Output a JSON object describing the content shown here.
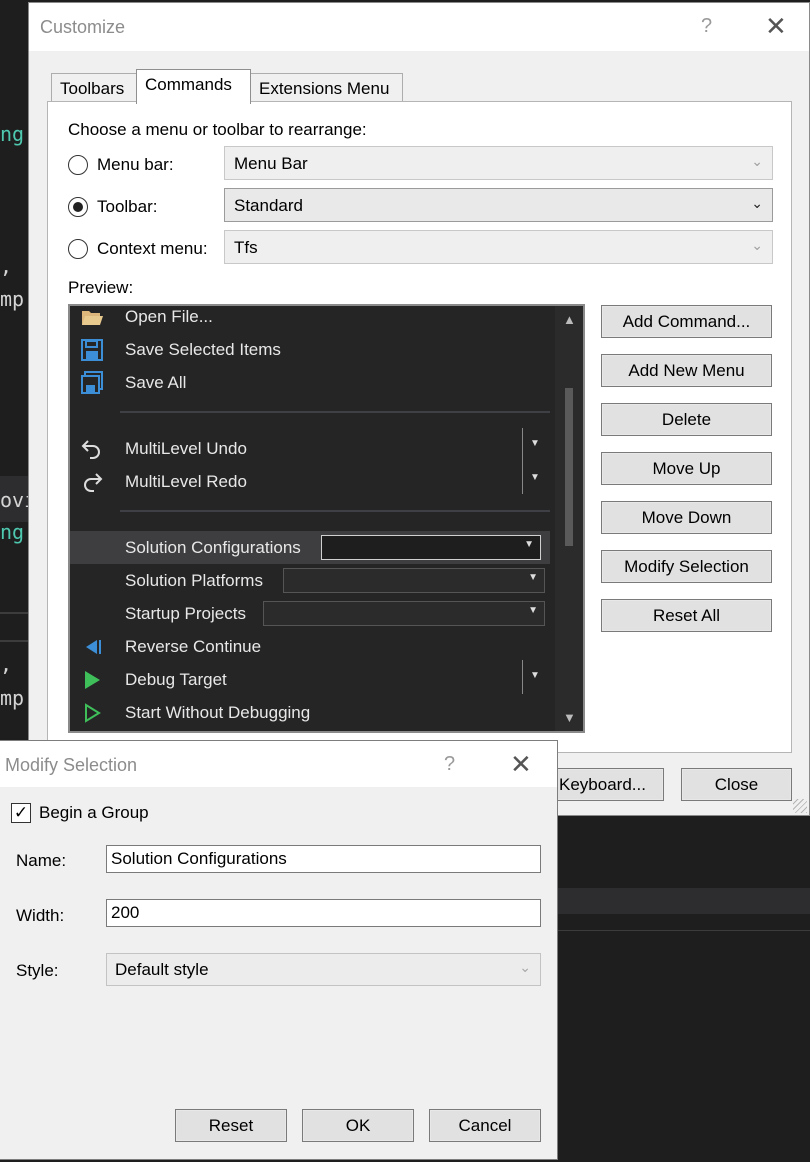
{
  "background": {
    "fragments": [
      ",",
      "mp",
      "ng",
      "ng",
      "ovi",
      ",",
      "mp"
    ]
  },
  "customize": {
    "title": "Customize",
    "help": "?",
    "close": "✕",
    "tabs": [
      "Toolbars",
      "Commands",
      "Extensions Menu"
    ],
    "active_tab": "Commands",
    "prompt": "Choose a menu or toolbar to rearrange:",
    "menu_bar": {
      "label": "Menu bar:",
      "value": "Menu Bar",
      "selected": false
    },
    "toolbar": {
      "label": "Toolbar:",
      "value": "Standard",
      "selected": true
    },
    "context_menu": {
      "label": "Context menu:",
      "value": "Tfs",
      "selected": false
    },
    "preview_label": "Preview:",
    "preview_items": {
      "open_file": "Open File...",
      "save_selected": "Save Selected Items",
      "save_all": "Save All",
      "undo": "MultiLevel Undo",
      "redo": "MultiLevel Redo",
      "solution_configs": "Solution Configurations",
      "solution_platforms": "Solution Platforms",
      "startup_projects": "Startup Projects",
      "reverse_continue": "Reverse Continue",
      "debug_target": "Debug Target",
      "start_without_debugging": "Start Without Debugging"
    },
    "buttons": {
      "add_command": "Add Command...",
      "add_new_menu": "Add New Menu",
      "delete": "Delete",
      "move_up": "Move Up",
      "move_down": "Move Down",
      "modify_selection": "Modify Selection",
      "reset_all": "Reset All",
      "keyboard": "Keyboard...",
      "close": "Close"
    },
    "colors": {
      "accent_blue": "#3c8ed6",
      "green": "#3fbf5a"
    }
  },
  "modify": {
    "title": "Modify Selection",
    "help": "?",
    "close": "✕",
    "begin_group": {
      "label": "Begin a Group",
      "checked": true
    },
    "name_label": "Name:",
    "name_value": "Solution Configurations",
    "width_label": "Width:",
    "width_value": "200",
    "style_label": "Style:",
    "style_value": "Default style",
    "buttons": {
      "reset": "Reset",
      "ok": "OK",
      "cancel": "Cancel"
    }
  }
}
